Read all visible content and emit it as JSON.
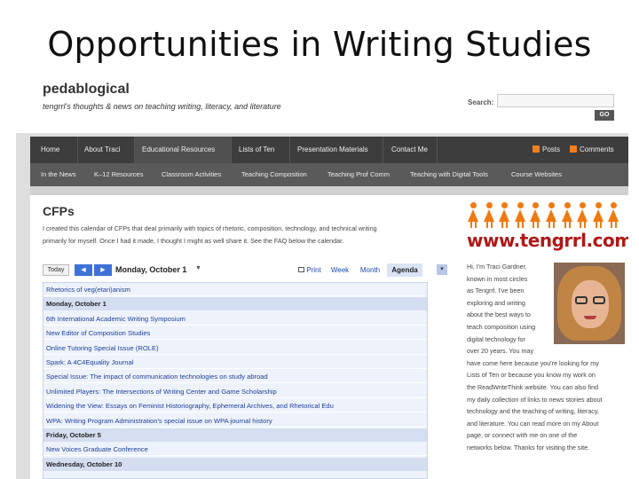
{
  "slide": {
    "title": "Opportunities in Writing Studies"
  },
  "blog": {
    "title": "pedablogical",
    "tagline": "tengrrl's thoughts & news on teaching writing, literacy, and literature",
    "search_label": "Search:",
    "search_placeholder": "",
    "go_label": "GO"
  },
  "nav": {
    "main": [
      "Home",
      "About Traci",
      "Educational Resources",
      "Lists of Ten",
      "Presentation Materials",
      "Contact Me"
    ],
    "feeds": [
      "Posts",
      "Comments"
    ],
    "sub": [
      "In the News",
      "K–12 Resources",
      "Classroom Activities",
      "Teaching Composition",
      "Teaching Prof Comm",
      "Teaching with Digital Tools",
      "Course Websites"
    ]
  },
  "content": {
    "heading": "CFPs",
    "intro": [
      "I created this calendar of CFPs that deal primarily with topics of rhetoric, composition, technology, and technical writing",
      "primarily for myself. Once I had it made, I thought I might as well share it. See the FAQ below the calendar."
    ]
  },
  "calendar": {
    "today_label": "Today",
    "prev_label": "◀",
    "next_label": "▶",
    "range_label": "Monday, October 1",
    "range_caret": "▼",
    "views": [
      "Print",
      "Week",
      "Month",
      "Agenda"
    ],
    "selected_view": "Agenda",
    "dropdown": "▾",
    "rows": [
      {
        "kind": "event",
        "text": "Rhetorics of veg(etari)anism"
      },
      {
        "kind": "date",
        "text": "Monday, October 1"
      },
      {
        "kind": "event",
        "text": "6th International Academic Writing Symposium"
      },
      {
        "kind": "event",
        "text": "New Editor of Composition Studies"
      },
      {
        "kind": "event",
        "text": "Online Tutoring Special Issue (ROLE)"
      },
      {
        "kind": "event",
        "text": "Spark: A 4C4Equality Journal"
      },
      {
        "kind": "event",
        "text": "Special Issue: The impact of communication technologies on study abroad"
      },
      {
        "kind": "event",
        "text": "Unlimited Players: The Intersections of Writing Center and Game Scholarship"
      },
      {
        "kind": "event",
        "text": "Widening the View: Essays on Feminist Historiography, Ephemeral Archives, and Rhetorical Edu"
      },
      {
        "kind": "event",
        "text": "WPA: Writing Program Administration's special issue on WPA journal history"
      },
      {
        "kind": "date",
        "text": "Friday, October 5"
      },
      {
        "kind": "event",
        "text": "New Voices Graduate Conference"
      },
      {
        "kind": "date",
        "text": "Wednesday, October 10"
      }
    ]
  },
  "sidebar": {
    "banner_text": "www.tengrrl.com",
    "bio": [
      "Hi, I'm Traci Gardner,",
      "known in most circles",
      "as Tengrrl. I've been",
      "exploring and writing",
      "about the best ways to",
      "teach composition using",
      "digital technology for",
      "over 20 years. You may",
      "have come here because you're looking for my",
      "Lists of Ten or because you know my work on",
      "the ReadWriteThink website. You can also find",
      "my daily collection of links to news stories about",
      "technology and the teaching of writing, literacy,",
      "and literature. You can read more on my About",
      "page, or connect with me on one of the",
      "networks below. Thanks for visiting the site."
    ]
  },
  "colors": {
    "nav_dark": "#3d3d3d",
    "nav_sub": "#5a5a5a",
    "link_blue": "#1d3f99",
    "banner_red": "#b01818",
    "figure_orange": "#f07a10"
  }
}
